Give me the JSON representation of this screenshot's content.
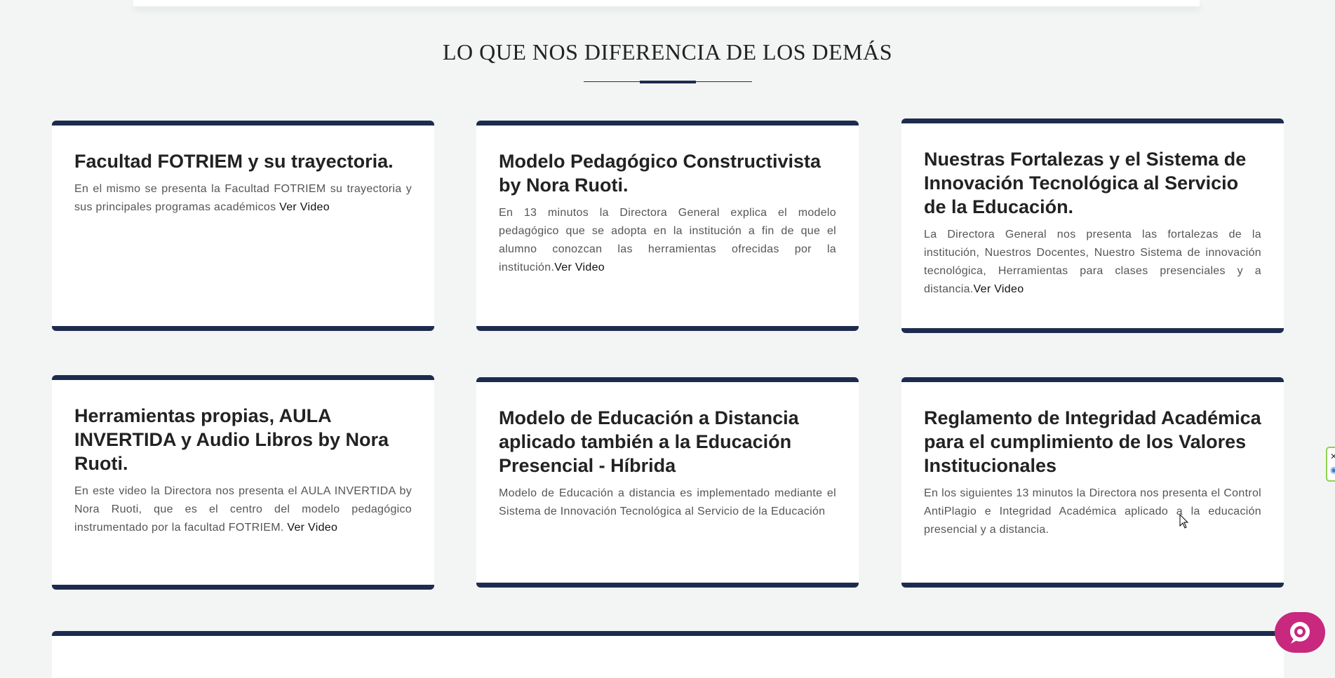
{
  "section": {
    "title": "LO QUE NOS DIFERENCIA DE LOS DEMÁS"
  },
  "cards": [
    {
      "title": "Facultad FOTRIEM y su trayectoria.",
      "description": "En el mismo se presenta la Facultad FOTRIEM su trayectoria y sus principales programas académicos",
      "link": "Ver Video"
    },
    {
      "title": "Modelo Pedagógico Constructivista by Nora Ruoti.",
      "description": "En 13 minutos la Directora General explica el modelo pedagógico que se adopta en la institución a fin de que el alumno conozcan las herramientas ofrecidas por la institución.",
      "link": "Ver Video"
    },
    {
      "title": "Nuestras Fortalezas y el Sistema de Innovación Tecnológica al Servicio de la Educación.",
      "description": "La Directora General nos presenta las fortalezas de la institución, Nuestros Docentes, Nuestro Sistema de innovación tecnológica, Herramientas para clases presenciales y a distancia.",
      "link": "Ver Video"
    },
    {
      "title": "Herramientas propias, AULA INVERTIDA y Audio Libros by Nora Ruoti.",
      "description": "En este video la Directora nos presenta el AULA INVERTIDA by Nora Ruoti, que es el centro del modelo pedagógico instrumentado por la facultad FOTRIEM.",
      "link": "Ver Video"
    },
    {
      "title": "Modelo de Educación a Distancia aplicado también a la Educación Presencial - Híbrida",
      "description": "Modelo de Educación a distancia es implementado mediante el Sistema de Innovación Tecnológica al Servicio de la Educación",
      "link": ""
    },
    {
      "title": "Reglamento de Integridad Académica para el cumplimiento de los Valores Institucionales",
      "description": "En los siguientes 13 minutos la Directora nos presenta el Control AntiPlagio e Integridad Académica aplicado a la educación presencial y a distancia.",
      "link": ""
    }
  ],
  "colors": {
    "accent": "#1d2b4f",
    "background": "#f2f5f4",
    "chat_button": "#c8287e"
  },
  "icons": {
    "chat": "chat-bubble-icon",
    "widget_close": "close-icon",
    "widget_info": "info-icon"
  }
}
